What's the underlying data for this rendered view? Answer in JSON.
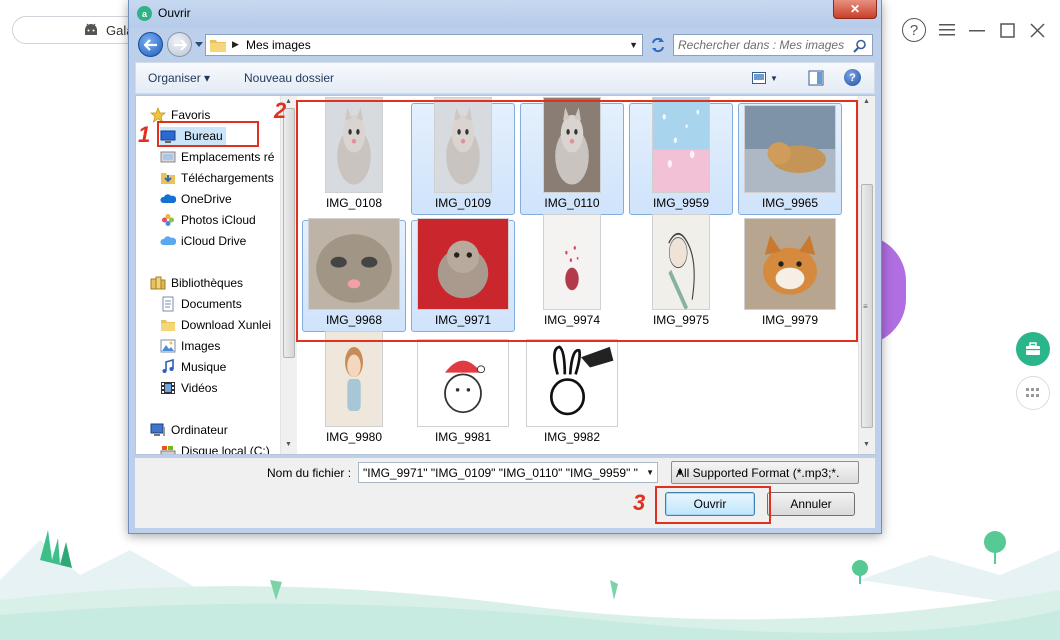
{
  "app": {
    "tab_label": "Gala",
    "help_glyph": "?",
    "colors": {
      "accent": "#2bb58b",
      "purple": "#b06ee0"
    }
  },
  "dialog": {
    "title": "Ouvrir",
    "close_glyph": "✕",
    "address": {
      "separator": "▶",
      "path_sep": "▶",
      "path": "Mes images"
    },
    "search": {
      "placeholder": "Rechercher dans : Mes images"
    },
    "toolbar": {
      "organize": "Organiser ▾",
      "new_folder": "Nouveau dossier",
      "help": "?"
    },
    "nav": {
      "favorites_header": "Favoris",
      "favorites": [
        {
          "label": "Bureau",
          "icon": "desktop-icon"
        },
        {
          "label": "Emplacements ré",
          "icon": "places-icon"
        },
        {
          "label": "Téléchargements",
          "icon": "downloads-icon"
        },
        {
          "label": "OneDrive",
          "icon": "onedrive-icon"
        },
        {
          "label": "Photos iCloud",
          "icon": "icloud-photos-icon"
        },
        {
          "label": "iCloud Drive",
          "icon": "icloud-drive-icon"
        }
      ],
      "libraries_header": "Bibliothèques",
      "libraries": [
        {
          "label": "Documents",
          "icon": "documents-icon"
        },
        {
          "label": "Download Xunlei",
          "icon": "folder-icon"
        },
        {
          "label": "Images",
          "icon": "images-icon"
        },
        {
          "label": "Musique",
          "icon": "music-icon"
        },
        {
          "label": "Vidéos",
          "icon": "videos-icon"
        }
      ],
      "computer_header": "Ordinateur",
      "computer": [
        {
          "label": "Disque local (C:)",
          "icon": "drive-icon"
        }
      ]
    },
    "files": [
      {
        "name": "IMG_0108",
        "selected": false,
        "kind": "cat-grey"
      },
      {
        "name": "IMG_0109",
        "selected": true,
        "kind": "cat-grey2"
      },
      {
        "name": "IMG_0110",
        "selected": true,
        "kind": "cat-happy"
      },
      {
        "name": "IMG_9959",
        "selected": true,
        "kind": "blossom"
      },
      {
        "name": "IMG_9965",
        "selected": true,
        "kind": "cat-grass"
      },
      {
        "name": "IMG_9968",
        "selected": true,
        "kind": "cat-face"
      },
      {
        "name": "IMG_9971",
        "selected": true,
        "kind": "cat-red"
      },
      {
        "name": "IMG_9974",
        "selected": false,
        "kind": "ornament"
      },
      {
        "name": "IMG_9975",
        "selected": false,
        "kind": "sketch-girl"
      },
      {
        "name": "IMG_9979",
        "selected": false,
        "kind": "dog"
      },
      {
        "name": "IMG_9980",
        "selected": false,
        "kind": "doll"
      },
      {
        "name": "IMG_9981",
        "selected": false,
        "kind": "bunny-hat"
      },
      {
        "name": "IMG_9982",
        "selected": false,
        "kind": "bunny-ink"
      }
    ],
    "footer": {
      "filename_label": "Nom du fichier :",
      "filename_value": "\"IMG_9971\" \"IMG_0109\" \"IMG_0110\" \"IMG_9959\" \"IM",
      "filter_value": "All Supported Format (*.mp3;*.",
      "open_label": "Ouvrir",
      "cancel_label": "Annuler"
    }
  },
  "annotations": {
    "step1": "1",
    "step2": "2",
    "step3": "3",
    "color": "#e0301e"
  }
}
